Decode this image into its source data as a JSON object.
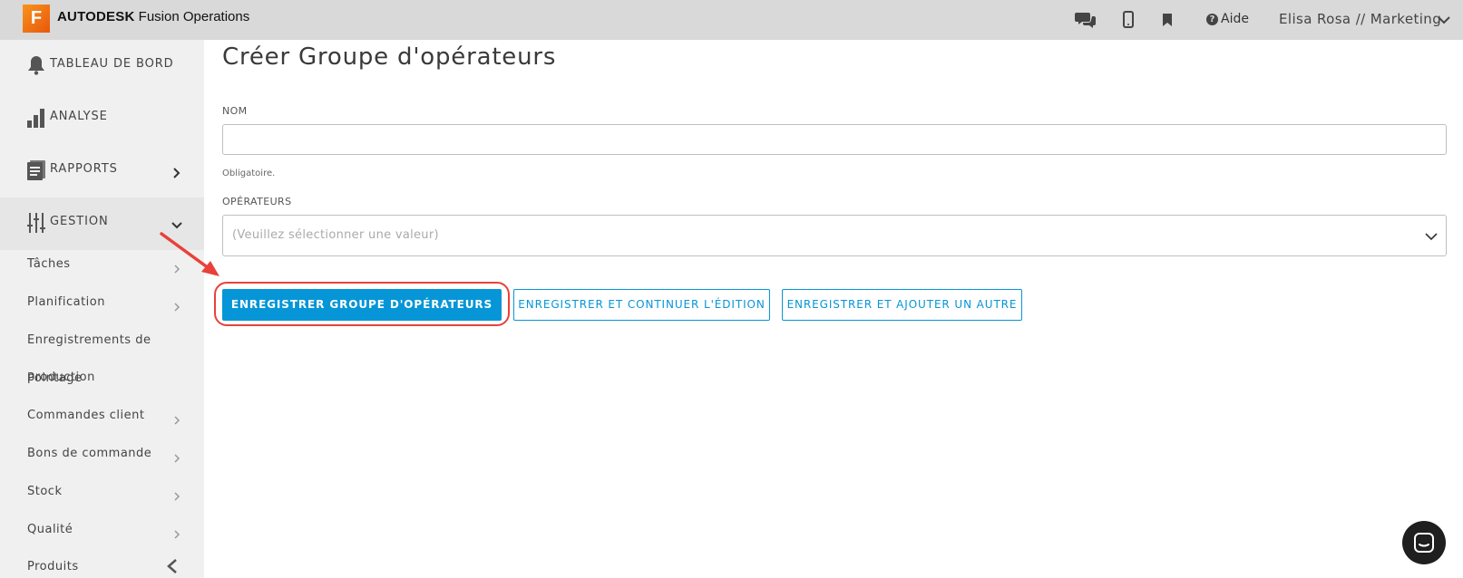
{
  "app": {
    "logo_letter": "F",
    "brand": "AUTODESK",
    "product": "Fusion Operations"
  },
  "topbar": {
    "icons": [
      "chat-icon",
      "mobile-icon",
      "bookmark-icon",
      "help-icon"
    ],
    "help_label": "Aide",
    "user_label": "Elisa Rosa // Marketing"
  },
  "sidebar": {
    "main_items": [
      {
        "label": "TABLEAU DE BORD",
        "icon": "bell-icon"
      },
      {
        "label": "ANALYSE",
        "icon": "bar-chart-icon"
      },
      {
        "label": "RAPPORTS",
        "icon": "report-icon"
      },
      {
        "label": "GESTION",
        "icon": "sliders-icon"
      }
    ],
    "sub_items": [
      {
        "label": "Tâches"
      },
      {
        "label": "Planification"
      },
      {
        "label": "Enregistrements de"
      },
      {
        "label": "production"
      },
      {
        "label": "Pointage"
      },
      {
        "label": "Commandes client"
      },
      {
        "label": "Bons de commande"
      },
      {
        "label": "Stock"
      },
      {
        "label": "Qualité"
      },
      {
        "label": "Produits"
      }
    ]
  },
  "form": {
    "title": "Créer Groupe d'opérateurs",
    "name_label": "NOM",
    "name_value": "",
    "name_hint": "Obligatoire.",
    "operators_label": "OPÉRATEURS",
    "operators_placeholder": "(Veuillez sélectionner une valeur)"
  },
  "actions": {
    "save_label": "ENREGISTRER GROUPE D'OPÉRATEURS",
    "save_continue_label": "ENREGISTRER ET CONTINUER L'ÉDITION",
    "save_add_label": "ENREGISTRER ET AJOUTER UN AUTRE"
  },
  "colors": {
    "accent": "#0696d7",
    "annotation": "#e8413a",
    "topbar_bg": "#d9d9d9",
    "sidebar_bg": "#f0f0f0"
  }
}
